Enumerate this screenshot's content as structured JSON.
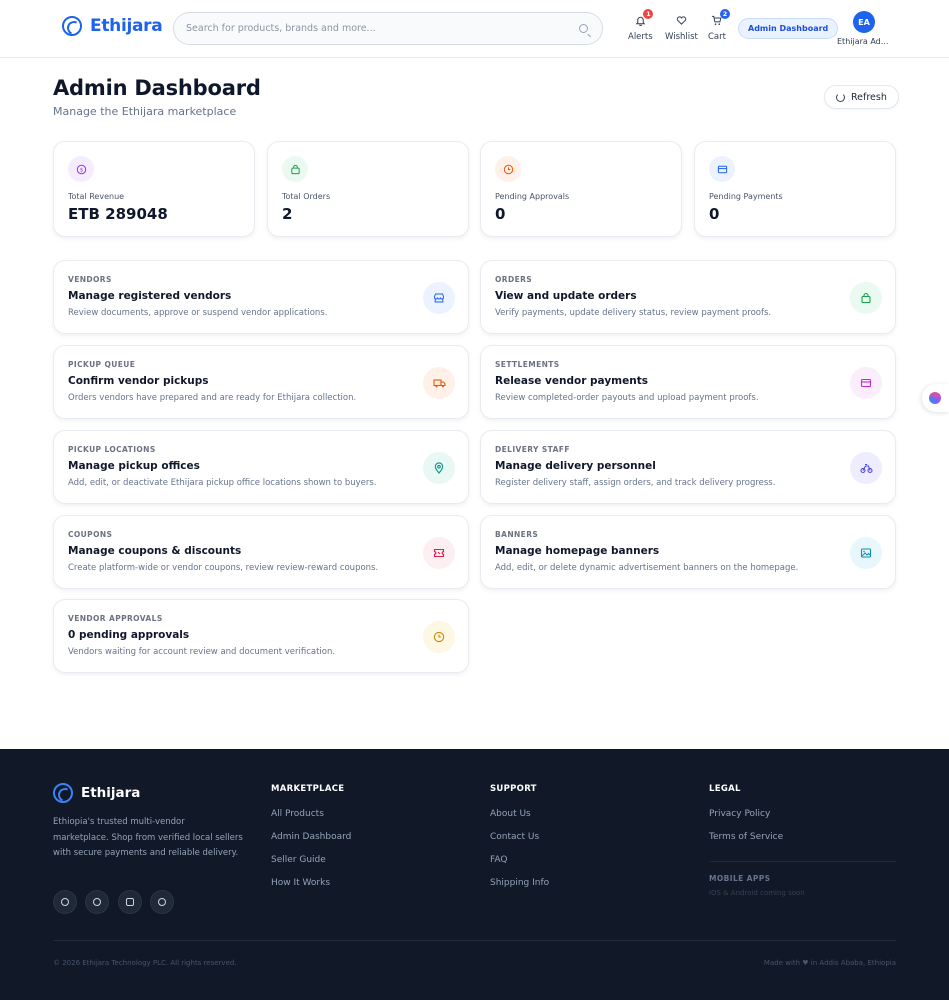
{
  "header": {
    "brand": "Ethijara",
    "search_placeholder": "Search for products, brands and more...",
    "nav": [
      {
        "label": "Alerts",
        "badge": "1",
        "icon": "bell-icon"
      },
      {
        "label": "Wishlist",
        "badge": "",
        "icon": "heart-icon"
      },
      {
        "label": "Cart",
        "badge": "2",
        "icon": "cart-icon"
      }
    ],
    "admin_button": "Admin Dashboard",
    "avatar_initials": "EA",
    "avatar_name": "Ethijara Ad..."
  },
  "page": {
    "title": "Admin Dashboard",
    "subtitle": "Manage the Ethijara marketplace",
    "refresh_label": "Refresh"
  },
  "stats": [
    {
      "label": "Total Revenue",
      "value": "ETB 289048",
      "icon": "dollar-icon",
      "color": "#9333ea",
      "bg": "#f5ecff"
    },
    {
      "label": "Total Orders",
      "value": "2",
      "icon": "bag-icon",
      "color": "#16a34a",
      "bg": "#eafaf0"
    },
    {
      "label": "Pending Approvals",
      "value": "0",
      "icon": "clock-icon",
      "color": "#ea580c",
      "bg": "#fff1e8"
    },
    {
      "label": "Pending Payments",
      "value": "0",
      "icon": "card-icon",
      "color": "#2563eb",
      "bg": "#ecf2ff"
    }
  ],
  "cards": [
    {
      "tag": "VENDORS",
      "title": "Manage registered vendors",
      "desc": "Review documents, approve or suspend vendor applications.",
      "icon": "store-icon",
      "color": "#2563eb",
      "bg": "#ecf2ff"
    },
    {
      "tag": "ORDERS",
      "title": "View and update orders",
      "desc": "Verify payments, update delivery status, review payment proofs.",
      "icon": "bag-icon",
      "color": "#16a34a",
      "bg": "#eafaf0"
    },
    {
      "tag": "PICKUP QUEUE",
      "title": "Confirm vendor pickups",
      "desc": "Orders vendors have prepared and are ready for Ethijara collection.",
      "icon": "truck-icon",
      "color": "#ea580c",
      "bg": "#fff1e8"
    },
    {
      "tag": "SETTLEMENTS",
      "title": "Release vendor payments",
      "desc": "Review completed-order payouts and upload payment proofs.",
      "icon": "wallet-icon",
      "color": "#c026d3",
      "bg": "#fbeefc"
    },
    {
      "tag": "PICKUP LOCATIONS",
      "title": "Manage pickup offices",
      "desc": "Add, edit, or deactivate Ethijara pickup office locations shown to buyers.",
      "icon": "map-pin-icon",
      "color": "#0d9488",
      "bg": "#e8f8f5"
    },
    {
      "tag": "DELIVERY STAFF",
      "title": "Manage delivery personnel",
      "desc": "Register delivery staff, assign orders, and track delivery progress.",
      "icon": "bike-icon",
      "color": "#4f46e5",
      "bg": "#eeedfd"
    },
    {
      "tag": "COUPONS",
      "title": "Manage coupons & discounts",
      "desc": "Create platform-wide or vendor coupons, review review-reward coupons.",
      "icon": "ticket-icon",
      "color": "#e11d48",
      "bg": "#fdeef1"
    },
    {
      "tag": "BANNERS",
      "title": "Manage homepage banners",
      "desc": "Add, edit, or delete dynamic advertisement banners on the homepage.",
      "icon": "image-icon",
      "color": "#0891b2",
      "bg": "#e8f7fb"
    },
    {
      "tag": "VENDOR APPROVALS",
      "title": "0 pending approvals",
      "desc": "Vendors waiting for account review and document verification.",
      "icon": "clock-icon",
      "color": "#ca8a04",
      "bg": "#fdf7e3"
    }
  ],
  "footer": {
    "brand": "Ethijara",
    "about": "Ethiopia's trusted multi-vendor marketplace. Shop from verified local sellers with secure payments and reliable delivery.",
    "social": [
      "telegram-icon",
      "tiktok-icon",
      "instagram-icon",
      "facebook-icon"
    ],
    "columns": [
      {
        "title": "MARKETPLACE",
        "links": [
          "All Products",
          "Admin Dashboard",
          "Seller Guide",
          "How It Works"
        ]
      },
      {
        "title": "SUPPORT",
        "links": [
          "About Us",
          "Contact Us",
          "FAQ",
          "Shipping Info"
        ]
      },
      {
        "title": "LEGAL",
        "links": [
          "Privacy Policy",
          "Terms of Service"
        ]
      }
    ],
    "mobile_title": "MOBILE APPS",
    "mobile_sub": "iOS & Android coming soon",
    "copyright": "© 2026 Ethijara Technology PLC. All rights reserved.",
    "made_with": "Made with ♥ in Addis Ababa, Ethiopia"
  }
}
